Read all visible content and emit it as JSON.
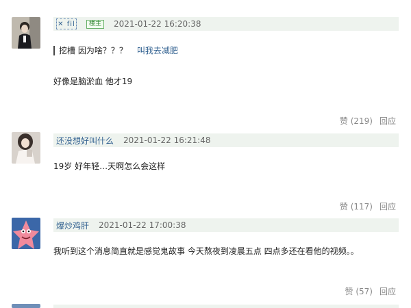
{
  "comments": [
    {
      "author": "",
      "time": "2021-01-22 16:20:38",
      "badge": "楼主",
      "quote": {
        "text": "挖槽 因为啥？？？",
        "name": "叫我去减肥"
      },
      "text": "好像是脑淤血 他才19",
      "like": "赞 (219)",
      "reply": "回应"
    },
    {
      "author": "还没想好叫什么",
      "time": "2021-01-22 16:21:48",
      "text": "19岁 好年轻…天啊怎么会这样",
      "like": "赞 (117)",
      "reply": "回应"
    },
    {
      "author": "爆炒鸡肝",
      "time": "2021-01-22 17:00:38",
      "text": "我听到这个消息简直就是感觉鬼故事 今天熬夜到凌晨五点 四点多还在看他的视频。。",
      "like": "赞 (57)",
      "reply": "回应"
    }
  ],
  "colors": {
    "header_bg": "#eef3ee",
    "username": "#2f5f8f",
    "action_text": "#888888"
  }
}
